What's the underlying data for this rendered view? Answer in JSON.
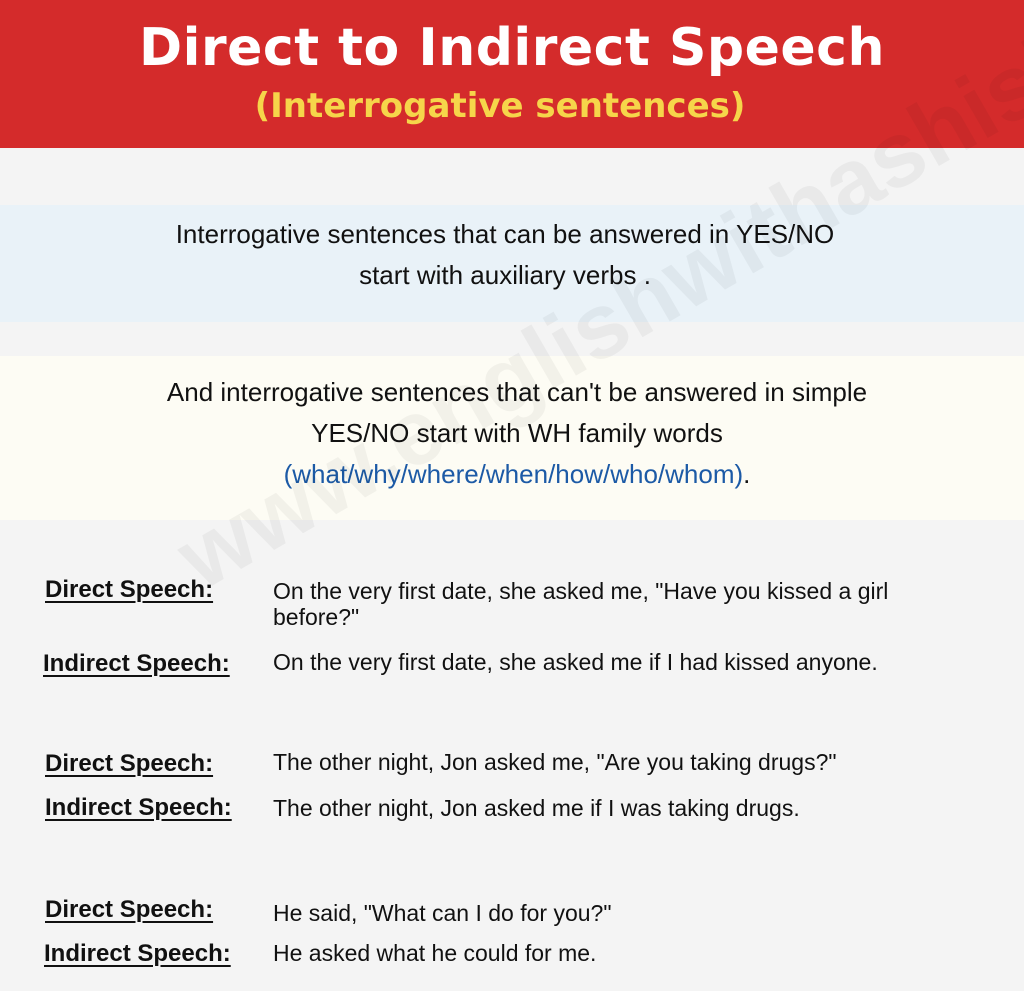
{
  "header": {
    "title": "Direct to Indirect Speech",
    "subtitle": "(Interrogative sentences)"
  },
  "intro": {
    "yes_no_line1": "Interrogative sentences that can be answered in YES/NO",
    "yes_no_line2": "start with auxiliary verbs .",
    "wh_line1": "And interrogative sentences that can't be answered in simple",
    "wh_line2": "YES/NO start with WH family words",
    "wh_words": "(what/why/where/when/how/who/whom)",
    "wh_period": "."
  },
  "watermark": "www.englishwithashish",
  "examples": [
    {
      "direct_label": "Direct Speech:",
      "direct_text": "On the very first date, she asked me, \"Have you kissed a girl before?\"",
      "indirect_label": "Indirect Speech:",
      "indirect_text": "On the very first date, she asked me if I had kissed anyone."
    },
    {
      "direct_label": "Direct Speech:",
      "direct_text": "The other night, Jon asked me, \"Are you taking drugs?\"",
      "indirect_label": "Indirect Speech:",
      "indirect_text": "The other night, Jon asked me if I was taking drugs."
    },
    {
      "direct_label": "Direct Speech:",
      "direct_text": "He said, \"What can I do for you?\"",
      "indirect_label": "Indirect Speech:",
      "indirect_text": "He asked what he could for me."
    }
  ],
  "colors": {
    "header_bg": "#d42b2b",
    "subtitle": "#f6d54a",
    "wh_words": "#1c5aa6"
  }
}
